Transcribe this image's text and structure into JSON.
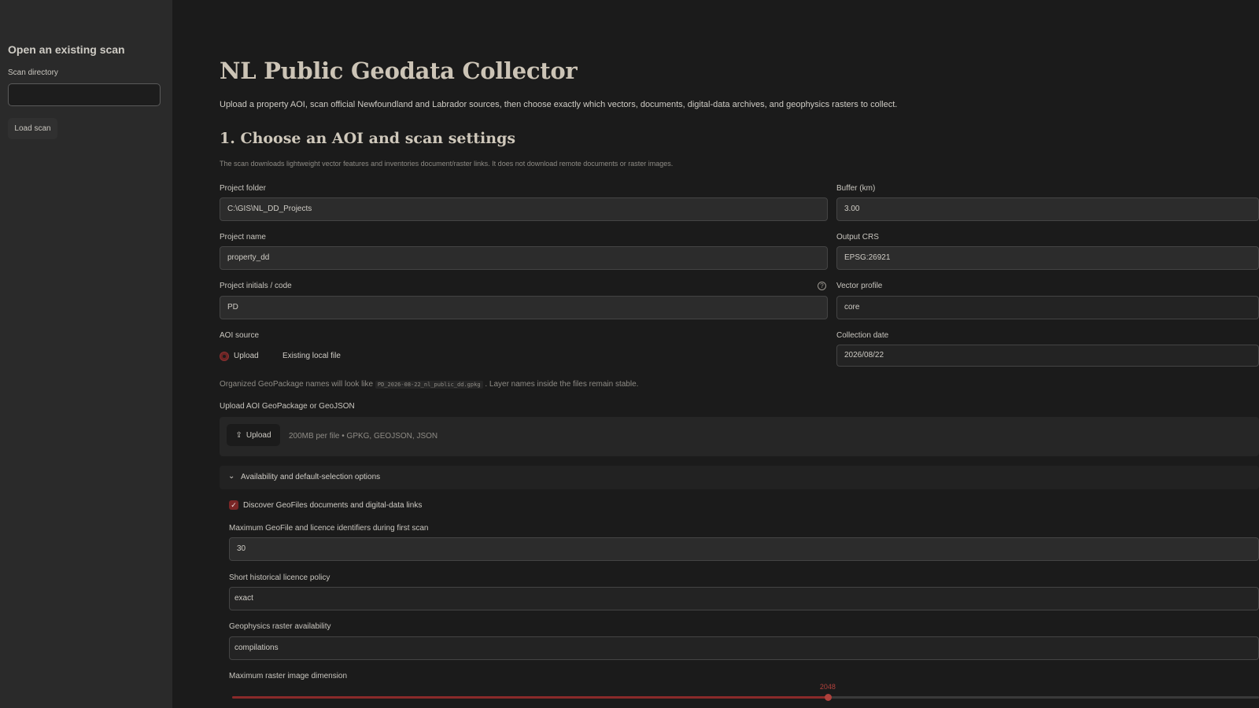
{
  "sidebar": {
    "title": "Open an existing scan",
    "scan_directory_label": "Scan directory",
    "scan_directory_value": "",
    "load_button": "Load scan"
  },
  "main": {
    "title": "NL Public Geodata Collector",
    "intro": "Upload a property AOI, scan official Newfoundland and Labrador sources, then choose exactly which vectors, documents, digital-data archives, and geophysics rasters to collect.",
    "section_title": "1. Choose an AOI and scan settings",
    "caption": "The scan downloads lightweight vector features and inventories document/raster links. It does not download remote documents or raster images.",
    "project_folder": {
      "label": "Project folder",
      "value": "C:\\GIS\\NL_DD_Projects"
    },
    "project_name": {
      "label": "Project name",
      "value": "property_dd"
    },
    "project_initials": {
      "label": "Project initials / code",
      "value": "PD",
      "help_icon": "question-circle-icon"
    },
    "buffer": {
      "label": "Buffer (km)",
      "value": "3.00"
    },
    "output_crs": {
      "label": "Output CRS",
      "value": "EPSG:26921"
    },
    "vector_profile": {
      "label": "Vector profile",
      "value": "core"
    },
    "collection_date": {
      "label": "Collection date",
      "value": "2026/08/22"
    },
    "aoi_source": {
      "label": "AOI source",
      "options": [
        "Upload",
        "Existing local file"
      ],
      "selected": "Upload"
    },
    "naming_note": {
      "prefix": "Organized GeoPackage names will look like",
      "example": "PD_2026-08-22_nl_public_dd.gpkg",
      "suffix": ". Layer names inside the files remain stable."
    },
    "upload": {
      "label": "Upload AOI GeoPackage or GeoJSON",
      "button": "Upload",
      "button_icon": "upload-icon",
      "hint": "200MB per file • GPKG, GEOJSON, JSON"
    },
    "expander": {
      "label": "Availability and default-selection options",
      "icon": "chevron-down-icon",
      "expanded": true
    },
    "discover_checkbox": {
      "label": "Discover GeoFiles documents and digital-data links",
      "checked": true
    },
    "max_geofile": {
      "label": "Maximum GeoFile and licence identifiers during first scan",
      "value": "30"
    },
    "historical_policy": {
      "label": "Short historical licence policy",
      "value": "exact"
    },
    "geophysics_availability": {
      "label": "Geophysics raster availability",
      "value": "compilations"
    },
    "max_raster": {
      "label": "Maximum raster image dimension",
      "value": "2048",
      "fraction": 0.58
    }
  },
  "colors": {
    "accent": "#b0413c",
    "background": "#1b1b1b",
    "sidebar": "#2a2a2a"
  }
}
